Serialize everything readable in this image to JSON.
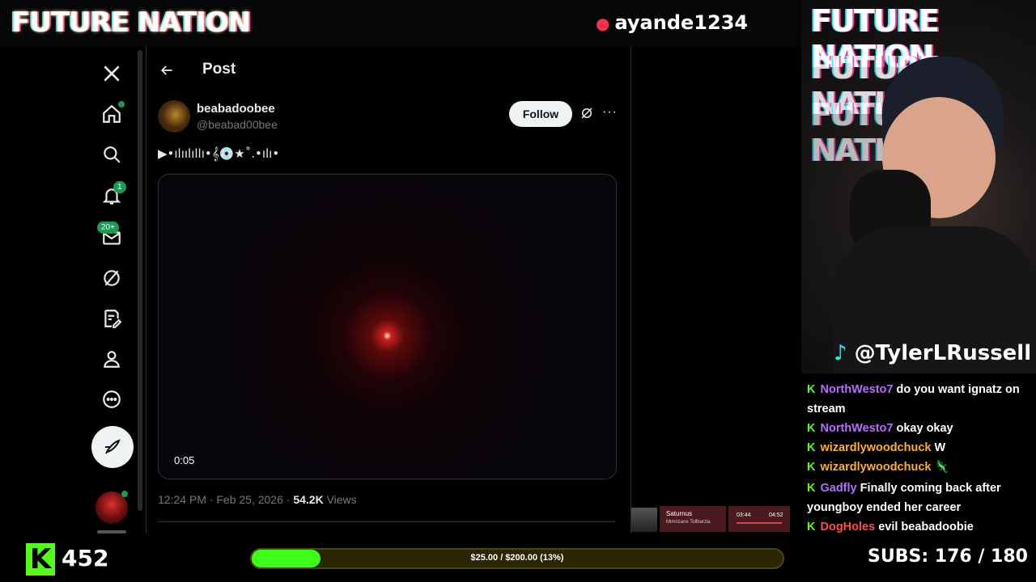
{
  "stream": {
    "brand_title": "FUTURE NATION",
    "top_handle": "ayande1234",
    "tiktok_handle": "@TylerLRussell",
    "viewer_count": "452",
    "goal": {
      "label": "$25.00 / $200.00 (13%)",
      "progress": 0.13
    },
    "subs": "SUBS:  176 / 180"
  },
  "nav": {
    "items": [
      "x-logo",
      "home",
      "search",
      "notifications",
      "messages",
      "grok",
      "premium",
      "profile",
      "more",
      "post"
    ],
    "notifications_badge": "1",
    "messages_badge": "20+"
  },
  "post": {
    "header": "Post",
    "author_name": "beabadoobee",
    "author_handle": "@beabad00bee",
    "follow_label": "Follow",
    "text": "▶•ılıılıllı•𝄞💿★˚.•ılı•",
    "video_time": "0:05",
    "timestamp": "12:24 PM · Feb 25, 2026 · ",
    "views_count": "54.2K",
    "views_label": " Views"
  },
  "music": {
    "track": "Saturnus",
    "artist": "Mimrizane Tollbarzia",
    "elapsed": "03:44",
    "duration": "04:52"
  },
  "chat": [
    {
      "user": "NorthWesto7",
      "color": "#b86bff",
      "message": "do you want ignatz on stream"
    },
    {
      "user": "NorthWesto7",
      "color": "#b86bff",
      "message": "okay okay"
    },
    {
      "user": "wizardlywoodchuck",
      "color": "#ffb020",
      "message": "W"
    },
    {
      "user": "wizardlywoodchuck",
      "color": "#ffb020",
      "message": "🦎"
    },
    {
      "user": "Gadfly",
      "color": "#b86bff",
      "message": "Finally coming back after youngboy ended her career"
    },
    {
      "user": "DogHoles",
      "color": "#ff4a4a",
      "message": "evil beabadoobie"
    }
  ],
  "colors": {
    "kick_green": "#53fc18",
    "x_bg": "#000000",
    "follow_bg": "#eff3f4"
  }
}
